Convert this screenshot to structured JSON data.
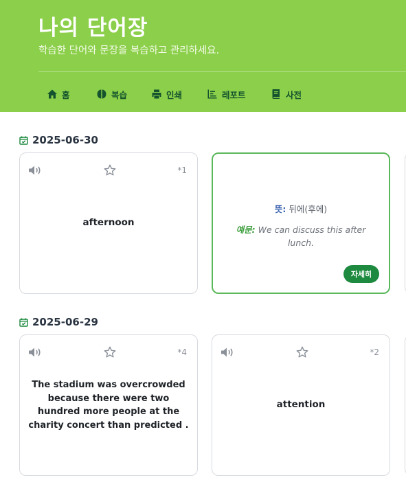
{
  "header": {
    "title": "나의 단어장",
    "subtitle": "학습한 단어와 문장을 복습하고 관리하세요.",
    "bg_color": "#8bcf4a"
  },
  "nav": {
    "items": [
      {
        "label": "홈",
        "icon": "home-icon"
      },
      {
        "label": "복습",
        "icon": "brain-icon"
      },
      {
        "label": "인쇄",
        "icon": "printer-icon"
      },
      {
        "label": "레포트",
        "icon": "report-icon"
      },
      {
        "label": "사전",
        "icon": "book-icon"
      }
    ]
  },
  "groups": [
    {
      "date": "2025-06-30",
      "cards": [
        {
          "text": "afternoon",
          "count": "*1"
        },
        {
          "meaning_label": "뜻:",
          "meaning": "뒤에(후에)",
          "example_label": "예문:",
          "example": "We can discuss this after lunch.",
          "button": "자세히"
        }
      ]
    },
    {
      "date": "2025-06-29",
      "cards": [
        {
          "text": "The stadium was overcrowded because there were two hundred more people at the charity concert than predicted .",
          "count": "*4"
        },
        {
          "text": "attention",
          "count": "*2"
        }
      ]
    }
  ],
  "colors": {
    "accent": "#1e8a3f",
    "meaning_label": "#3b63b0",
    "example_label": "#3a9d3a"
  }
}
